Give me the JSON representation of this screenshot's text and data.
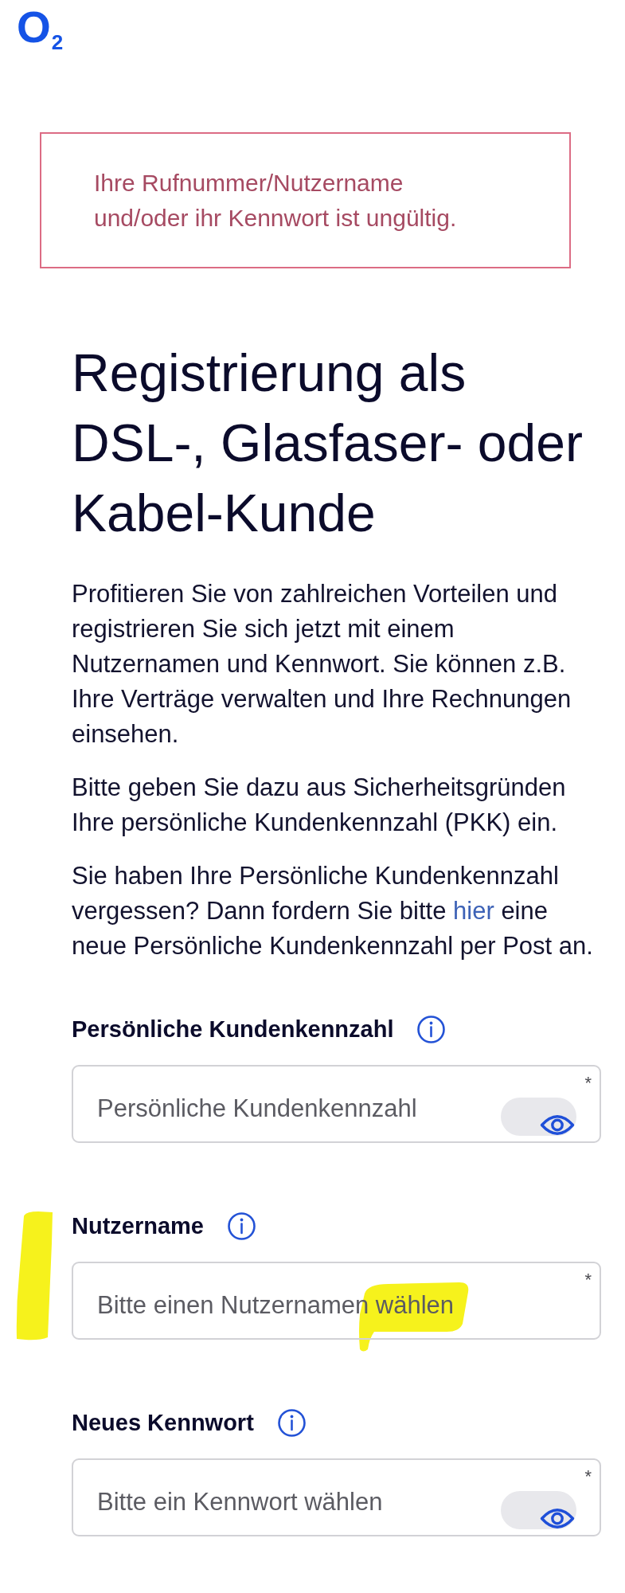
{
  "logo": {
    "text": "O$_{2}$"
  },
  "error_message": {
    "text": "Ihre Rufnummer/Nutzername und/oder ihr Kennwort ist ungültig."
  },
  "heading": "Registrierung als DSL-, Glasfaser- oder Kabel-Kunde",
  "paragraphs": [
    {
      "segments": [
        {
          "kind": "text",
          "text": "Profitieren Sie von zahlreichen Vorteilen und registrieren Sie sich jetzt mit einem Nutzernamen und Kennwort. Sie können z.B. Ihre Verträge verwalten und Ihre Rechnungen einsehen."
        }
      ]
    },
    {
      "segments": [
        {
          "kind": "text",
          "text": "Bitte geben Sie dazu aus Sicherheitsgründen Ihre persönliche Kundenkennzahl (PKK) ein."
        }
      ]
    },
    {
      "segments": [
        {
          "kind": "text",
          "text": "Sie haben Ihre Persönliche Kundenkennzahl vergessen? Dann fordern Sie bitte "
        },
        {
          "kind": "link",
          "text": "hier"
        },
        {
          "kind": "text",
          "text": " eine neue Persönliche Kundenkennzahl per Post an."
        }
      ]
    }
  ],
  "fields": [
    {
      "label": "Persönliche Kundenkennzahl",
      "kind": "secret",
      "placeholder": "Persönliche Kundenkennzahl",
      "required_mark": "*",
      "highlighted": false
    },
    {
      "label": "Nutzername",
      "kind": "text",
      "placeholder": "Bitte einen Nutzernamen wählen",
      "required_mark": "*",
      "highlighted": true
    },
    {
      "label": "Neues Kennwort",
      "kind": "secret",
      "placeholder": "Bitte ein Kennwort wählen",
      "required_mark": "*",
      "highlighted": false
    }
  ]
}
